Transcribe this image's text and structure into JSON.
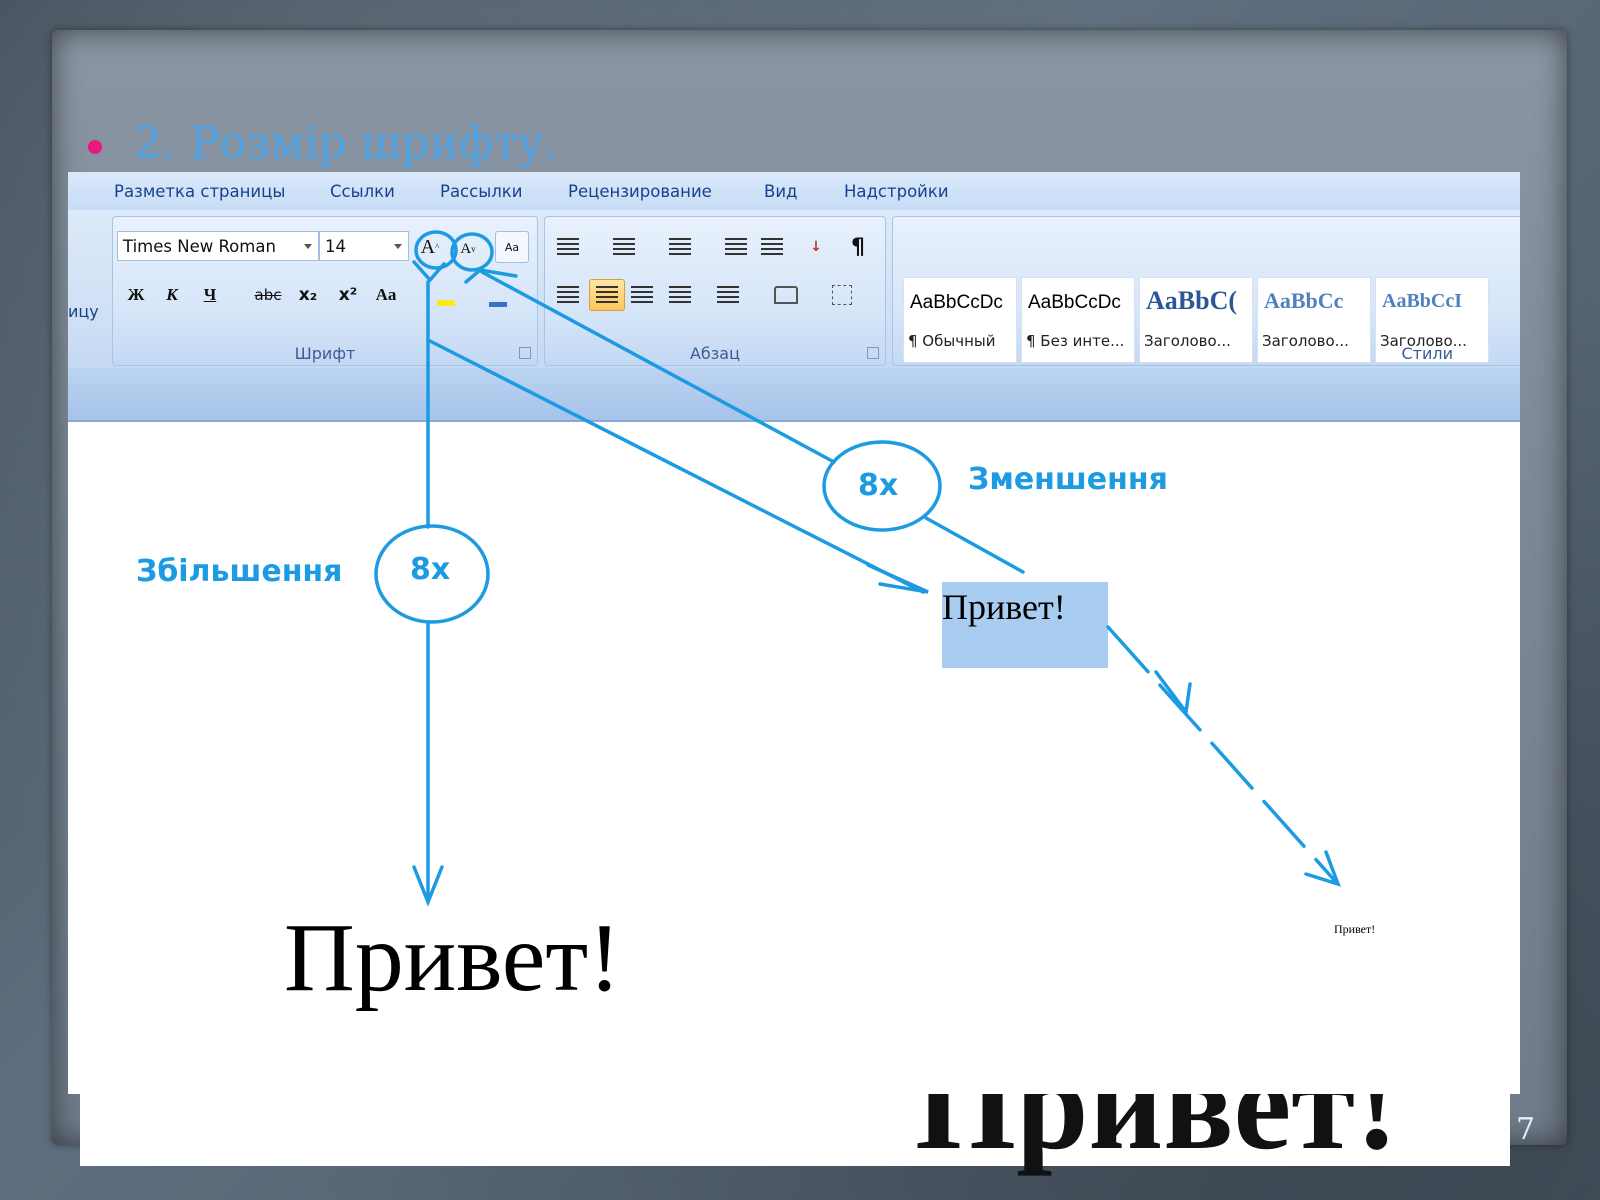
{
  "slide": {
    "bullet_text": "2. Розмір шрифту.",
    "page_number": "7",
    "under_text": "Привет!",
    "accent_bullet_color": "#e8197c",
    "heading_color": "#4ea3e6"
  },
  "ribbon": {
    "tabs": [
      "Разметка страницы",
      "Ссылки",
      "Рассылки",
      "Рецензирование",
      "Вид",
      "Надстройки"
    ],
    "left_cut_label": "ицу",
    "font_group": {
      "label": "Шрифт",
      "font_name": "Times New Roman",
      "font_size": "14",
      "grow_font_label": "A",
      "shrink_font_label": "A",
      "buttons": [
        "Ж",
        "К",
        "Ч",
        "abc",
        "x₂",
        "x²",
        "Aa"
      ]
    },
    "paragraph_group": {
      "label": "Абзац"
    },
    "styles_group": {
      "label": "Стили",
      "items": [
        {
          "sample": "AaBbCcDc",
          "name": "¶ Обычный"
        },
        {
          "sample": "AaBbCcDc",
          "name": "¶ Без инте..."
        },
        {
          "sample": "AaBbC(",
          "name": "Заголово..."
        },
        {
          "sample": "AaBbCc",
          "name": "Заголово..."
        },
        {
          "sample": "AaBbCcI",
          "name": "Заголово..."
        }
      ]
    }
  },
  "document": {
    "big_text": "Привет!",
    "mid_text": "Привет!",
    "small_text": "Привет!"
  },
  "annotations": {
    "increase_label": "Збільшення",
    "decrease_label": "Зменшення",
    "increase_times": "8x",
    "decrease_times": "8x",
    "color": "#1c9be3"
  }
}
